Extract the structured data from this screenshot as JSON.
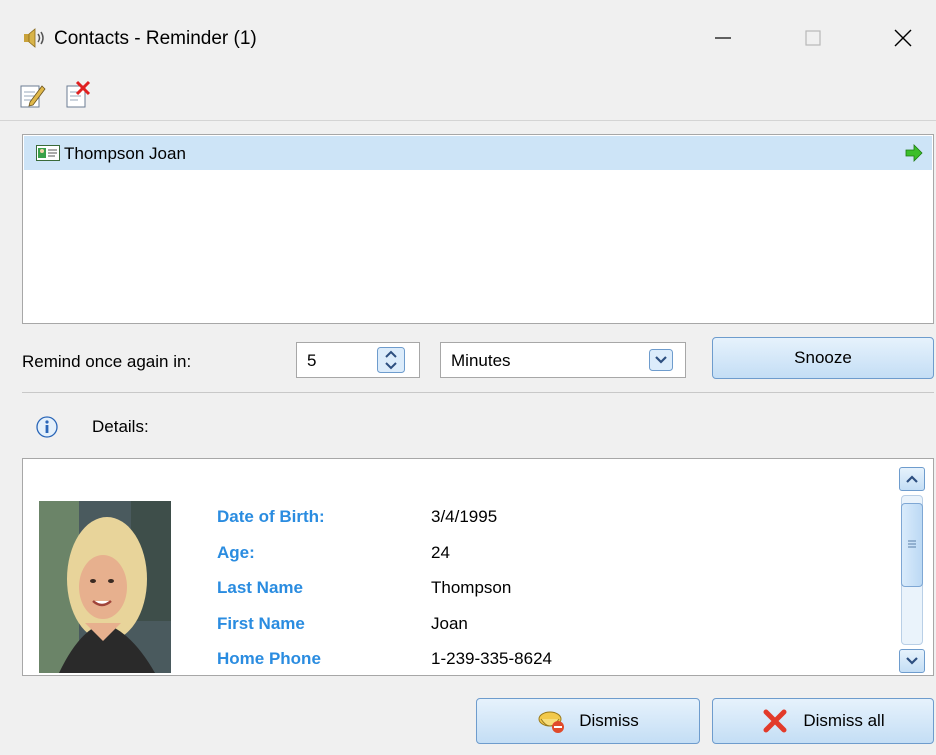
{
  "window": {
    "title": "Contacts - Reminder (1)",
    "icon": "speaker-icon",
    "controls": [
      "minimize-icon",
      "maximize-icon",
      "close-icon"
    ]
  },
  "toolbar": {
    "icons": [
      "edit-contact-icon",
      "delete-contact-icon"
    ]
  },
  "reminders": {
    "items": [
      {
        "label": "Thompson Joan",
        "icon": "contact-card-icon",
        "action_icon": "green-arrow-icon",
        "selected": true
      }
    ]
  },
  "snooze": {
    "label": "Remind once again in:",
    "value": "5",
    "unit": "Minutes",
    "button_label": "Snooze"
  },
  "details": {
    "label": "Details:",
    "fields": [
      {
        "label": "Date of Birth:",
        "value": "3/4/1995"
      },
      {
        "label": "Age:",
        "value": "24"
      },
      {
        "label": "Last Name",
        "value": "Thompson"
      },
      {
        "label": "First Name",
        "value": "Joan"
      },
      {
        "label": "Home Phone",
        "value": "1-239-335-8624"
      }
    ],
    "label_color": "#2a8ce0"
  },
  "footer": {
    "dismiss_label": "Dismiss",
    "dismiss_all_label": "Dismiss all"
  },
  "colors": {
    "selection": "#cde4f7",
    "button_border": "#6e9ccd"
  }
}
